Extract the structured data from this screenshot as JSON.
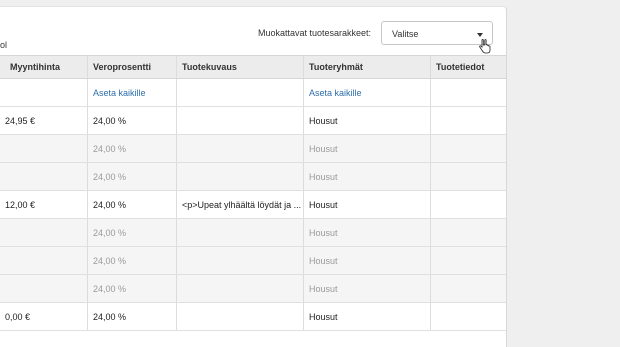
{
  "header": {
    "left_stub": "ol",
    "custom_columns_label": "Muokattavat tuotesarakkeet:",
    "select_value": "Valitse"
  },
  "table": {
    "columns": [
      "Myyntihinta",
      "Veroprosentti",
      "Tuotekuvaus",
      "Tuoteryhmät",
      "Tuotetiedot"
    ],
    "set_all": {
      "vat": "Aseta kaikille",
      "group": "Aseta kaikille"
    },
    "rows": [
      {
        "price": "24,95 €",
        "vat": "24,00 %",
        "desc": "",
        "group": "Housut",
        "info": ""
      },
      {
        "price": "",
        "vat": "24,00 %",
        "desc": "",
        "group": "Housut",
        "info": ""
      },
      {
        "price": "",
        "vat": "24,00 %",
        "desc": "",
        "group": "Housut",
        "info": ""
      },
      {
        "price": "12,00 €",
        "vat": "24,00 %",
        "desc": "<p>Upeat ylhäältä löydät ja ...",
        "group": "Housut",
        "info": ""
      },
      {
        "price": "",
        "vat": "24,00 %",
        "desc": "",
        "group": "Housut",
        "info": ""
      },
      {
        "price": "",
        "vat": "24,00 %",
        "desc": "",
        "group": "Housut",
        "info": ""
      },
      {
        "price": "",
        "vat": "24,00 %",
        "desc": "",
        "group": "Housut",
        "info": ""
      },
      {
        "price": "0,00 €",
        "vat": "24,00 %",
        "desc": "",
        "group": "Housut",
        "info": ""
      }
    ]
  },
  "icons": {
    "dropdown": "chevron-down-icon",
    "cursor": "hand-pointer-icon"
  }
}
